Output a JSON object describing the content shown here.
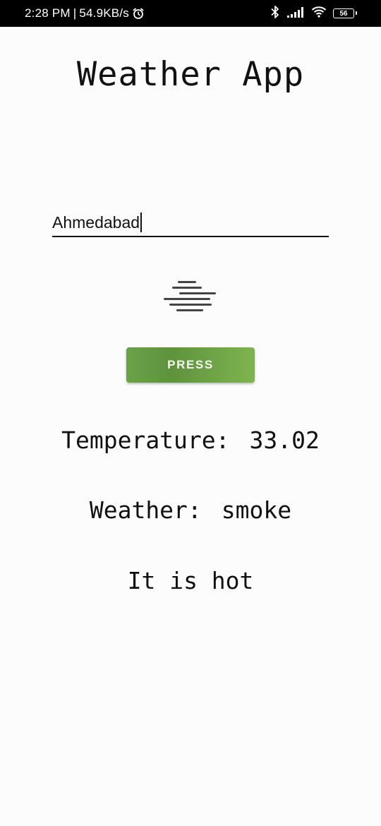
{
  "status_bar": {
    "time": "2:28 PM",
    "separator": "|",
    "network_speed": "54.9KB/s",
    "icons": [
      "alarm-icon",
      "bluetooth-icon",
      "signal-icon",
      "wifi-icon",
      "battery-icon"
    ],
    "battery_level": "56"
  },
  "app": {
    "title": "Weather App"
  },
  "city_input": {
    "value": "Ahmedabad"
  },
  "weather_icon": "haze-lines-icon",
  "press_button": {
    "label": "PRESS"
  },
  "results": {
    "temperature_label": "Temperature:",
    "temperature_value": "33.02",
    "weather_label": "Weather:",
    "weather_value": "smoke",
    "remark": "It is hot"
  },
  "colors": {
    "status_bar_bg": "#000000",
    "page_bg": "#fcfcfc",
    "button_green": "#6aa24a",
    "text": "#111111"
  }
}
